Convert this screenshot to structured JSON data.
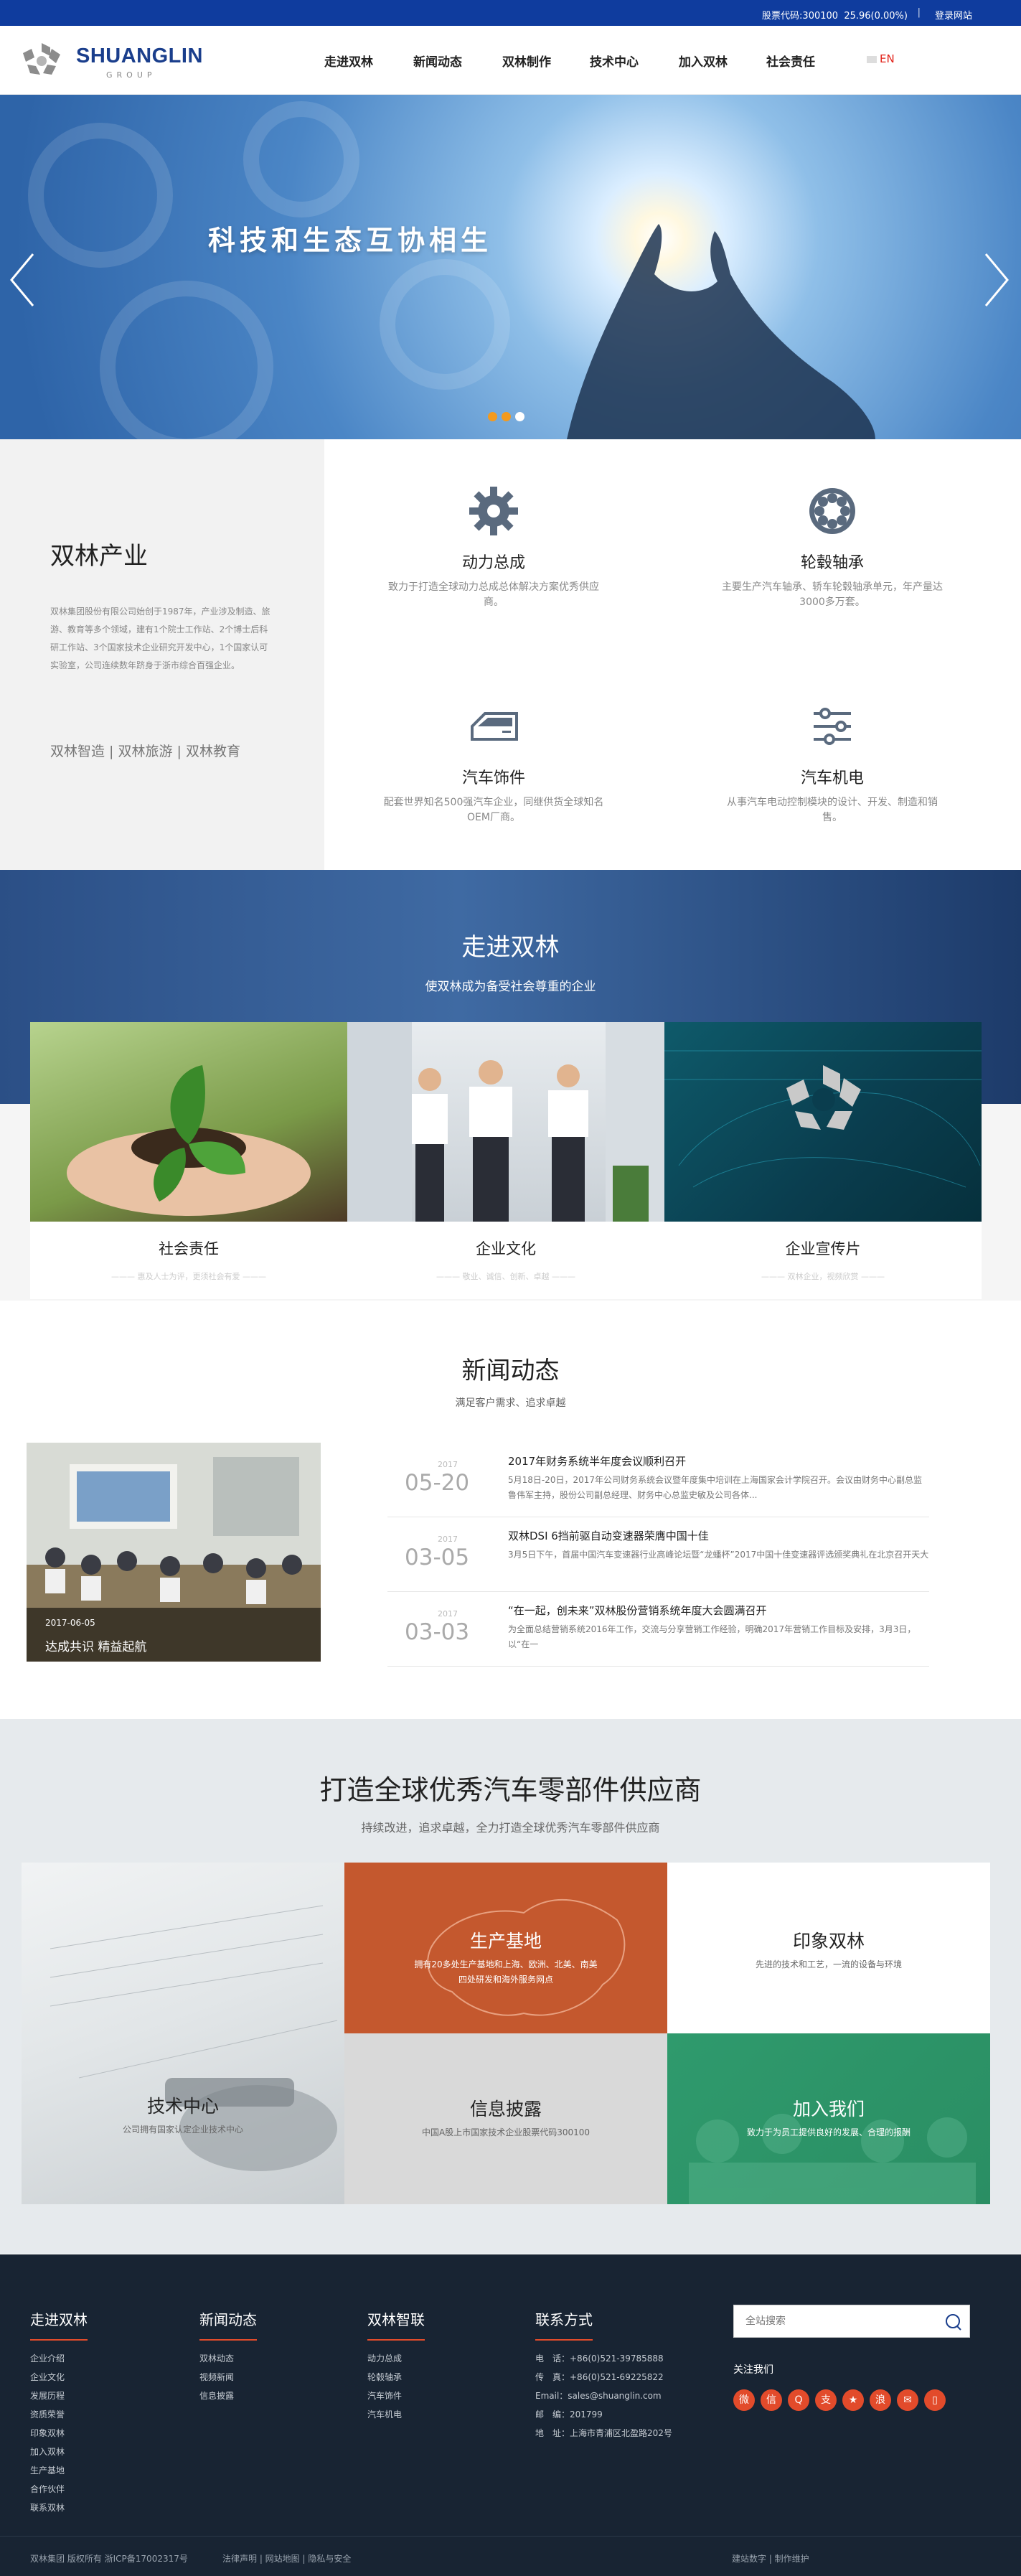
{
  "topbar": {
    "stock": "股票代码:300100 &nbsp;25.96(0.00%)",
    "stock_code": "股票代码:300100",
    "stock_price": "25.96(0.00%)",
    "separator": "|",
    "login": "登录网站"
  },
  "header": {
    "logo_name": "SHUANGLIN",
    "logo_sub": "GROUP",
    "nav": [
      "走进双林",
      "新闻动态",
      "双林制作",
      "技术中心",
      "加入双林",
      "社会责任"
    ],
    "lang": "EN"
  },
  "banner": {
    "slogan": "科技和生态互协相生",
    "slides": 3,
    "active_slide": 1
  },
  "industry": {
    "title": "双林产业",
    "desc": "双林集团股份有限公司始创于1987年，产业涉及制造、旅游、教育等多个领域，建有1个院士工作站、2个博士后科研工作站、3个国家技术企业研究开发中心，1个国家认可实验室，公司连续数年跻身于浙市综合百强企业。",
    "links": "双林智造 | 双林旅游 | 双林教育",
    "items": [
      {
        "title": "动力总成",
        "desc": "致力于打造全球动力总成总体解决方案优秀供应商。",
        "icon": "gear-icon"
      },
      {
        "title": "轮毂轴承",
        "desc": "主要生产汽车轴承、轿车轮毂轴承单元，年产量达3000多万套。",
        "icon": "bearing-icon"
      },
      {
        "title": "汽车饰件",
        "desc": "配套世界知名500强汽车企业，同继供货全球知名OEM厂商。",
        "icon": "car-door-icon"
      },
      {
        "title": "汽车机电",
        "desc": "从事汽车电动控制模块的设计、开发、制造和销售。",
        "icon": "sliders-icon"
      }
    ]
  },
  "about": {
    "title": "走进双林",
    "subtitle": "使双林成为备受社会尊重的企业",
    "cards": [
      {
        "title": "社会责任",
        "sub": "——— 惠及人士为评，更须社会有爱 ———"
      },
      {
        "title": "企业文化",
        "sub": "——— 敬业、诚信、创新、卓越 ———"
      },
      {
        "title": "企业宣传片",
        "sub": "——— 双林企业，视频欣赏 ———"
      }
    ]
  },
  "news": {
    "title": "新闻动态",
    "subtitle": "满足客户需求、追求卓越",
    "featured": {
      "date": "2017-06-05",
      "title": "达成共识 精益起航"
    },
    "items": [
      {
        "year": "2017",
        "md": "05-20",
        "title": "2017年财务系统半年度会议顺利召开",
        "desc": "5月18日-20日，2017年公司财务系统会议暨年度集中培训在上海国家会计学院召开。会议由财务中心副总监鲁伟军主持，股份公司副总经理、财务中心总监史敏及公司各体..."
      },
      {
        "year": "2017",
        "md": "03-05",
        "title": "双林DSI 6挡前驱自动变速器荣膺中国十佳",
        "desc": "3月5日下午，首届中国汽车变速器行业高峰论坛暨“龙蟠杯”2017中国十佳变速器评选颁奖典礼在北京召开天大"
      },
      {
        "year": "2017",
        "md": "03-03",
        "title": "“在一起，创未来”双林股份营销系统年度大会圆满召开",
        "desc": "为全面总结营销系统2016年工作，交流与分享营销工作经验，明确2017年营销工作目标及安排，3月3日，以“在一"
      }
    ]
  },
  "supplier": {
    "title": "打造全球优秀汽车零部件供应商",
    "subtitle": "持续改进，追求卓越，全力打造全球优秀汽车零部件供应商",
    "tiles": {
      "base": {
        "title": "生产基地",
        "desc": "拥有20多处生产基地和上海、欧洲、北美、南美四处研发和海外服务网点"
      },
      "impression": {
        "title": "印象双林",
        "desc": "先进的技术和工艺，一流的设备与环境"
      },
      "tech": {
        "title": "技术中心",
        "desc": "公司拥有国家认定企业技术中心"
      },
      "info": {
        "title": "信息披露",
        "desc": "中国A股上市国家技术企业股票代码300100"
      },
      "join": {
        "title": "加入我们",
        "desc": "致力于为员工提供良好的发展、合理的报酬"
      }
    }
  },
  "footer": {
    "cols": [
      {
        "title": "走进双林",
        "links": [
          "企业介绍",
          "企业文化",
          "发展历程",
          "资质荣誉",
          "印象双林",
          "加入双林",
          "生产基地",
          "合作伙伴",
          "联系双林"
        ]
      },
      {
        "title": "新闻动态",
        "links": [
          "双林动态",
          "视频新闻",
          "信息披露"
        ]
      },
      {
        "title": "双林智联",
        "links": [
          "动力总成",
          "轮毂轴承",
          "汽车饰件",
          "汽车机电"
        ]
      },
      {
        "title": "联系方式",
        "links": [
          "电　话：+86(0)521-39785888",
          "传　真：+86(0)521-69225822",
          "Email：sales@shuanglin.com",
          "邮　编：201799",
          "地　址：上海市青浦区北盈路202号"
        ]
      }
    ],
    "search_placeholder": "全站搜索",
    "follow": "关注我们",
    "social": [
      "weibo-icon",
      "wechat-icon",
      "qq-icon",
      "alipay-icon",
      "star-icon",
      "sina-icon",
      "mail-icon",
      "mobile-icon"
    ],
    "copyright": "双林集团 版权所有 浙ICP备17002317号",
    "legal": "法律声明 | 网站地图 | 隐私与安全",
    "credit": "建站数字 | 制作维护"
  }
}
